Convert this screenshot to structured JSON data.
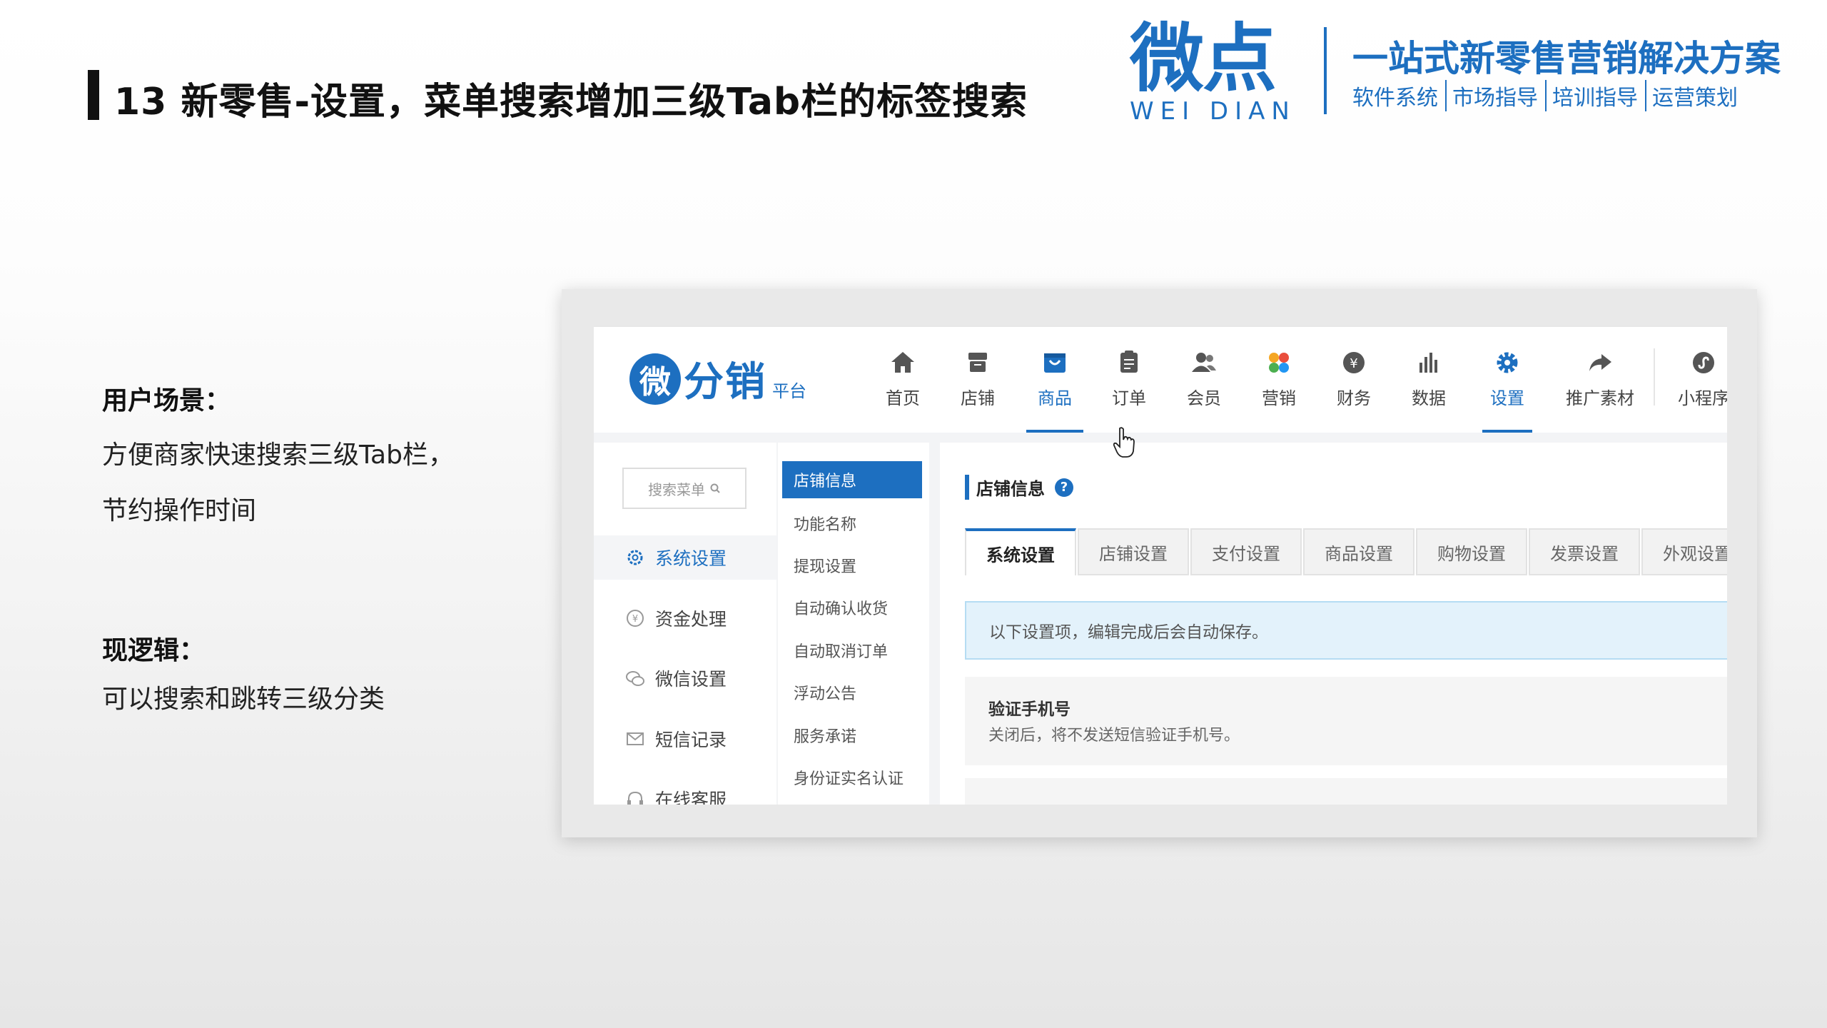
{
  "slide": {
    "title": "13 新零售-设置，菜单搜索增加三级Tab栏的标签搜索"
  },
  "brand": {
    "name_cn": "微点",
    "name_en": "WEI DIAN",
    "slogan": "一站式新零售营销解决方案",
    "services": [
      "软件系统",
      "市场指导",
      "培训指导",
      "运营策划"
    ],
    "color": "#1d6fc0"
  },
  "description": {
    "scenario_heading": "用户场景：",
    "scenario_lines": [
      "方便商家快速搜索三级Tab栏，",
      "节约操作时间"
    ],
    "logic_heading": "现逻辑：",
    "logic_lines": [
      "可以搜索和跳转三级分类"
    ]
  },
  "app": {
    "logo_badge": "微",
    "logo_text": "分销",
    "logo_sub": "平台",
    "accent": "#1d6fc0",
    "nav": [
      {
        "label": "首页",
        "icon": "home-icon"
      },
      {
        "label": "店铺",
        "icon": "store-icon"
      },
      {
        "label": "商品",
        "icon": "goods-icon",
        "active": true
      },
      {
        "label": "订单",
        "icon": "order-icon"
      },
      {
        "label": "会员",
        "icon": "member-icon"
      },
      {
        "label": "营销",
        "icon": "marketing-icon"
      },
      {
        "label": "财务",
        "icon": "finance-icon"
      },
      {
        "label": "数据",
        "icon": "chart-icon"
      },
      {
        "label": "设置",
        "icon": "gear-icon",
        "active": true
      },
      {
        "label": "推广素材",
        "icon": "share-icon"
      },
      {
        "label": "小程序",
        "icon": "miniapp-icon"
      }
    ],
    "sidebar_search_placeholder": "搜索菜单",
    "sidebar": [
      {
        "label": "系统设置",
        "icon": "gear-icon",
        "active": true
      },
      {
        "label": "资金处理",
        "icon": "yuan-icon"
      },
      {
        "label": "微信设置",
        "icon": "wechat-icon"
      },
      {
        "label": "短信记录",
        "icon": "mail-icon"
      },
      {
        "label": "在线客服",
        "icon": "headset-icon"
      }
    ],
    "submenu": [
      "店铺信息",
      "功能名称",
      "提现设置",
      "自动确认收货",
      "自动取消订单",
      "浮动公告",
      "服务承诺",
      "身份证实名认证"
    ],
    "content_title": "店铺信息",
    "help_glyph": "?",
    "tabs": [
      "系统设置",
      "店铺设置",
      "支付设置",
      "商品设置",
      "购物设置",
      "发票设置",
      "外观设置"
    ],
    "notice": "以下设置项，编辑完成后会自动保存。",
    "setting_title": "验证手机号",
    "setting_desc": "关闭后，将不发送短信验证手机号。"
  }
}
